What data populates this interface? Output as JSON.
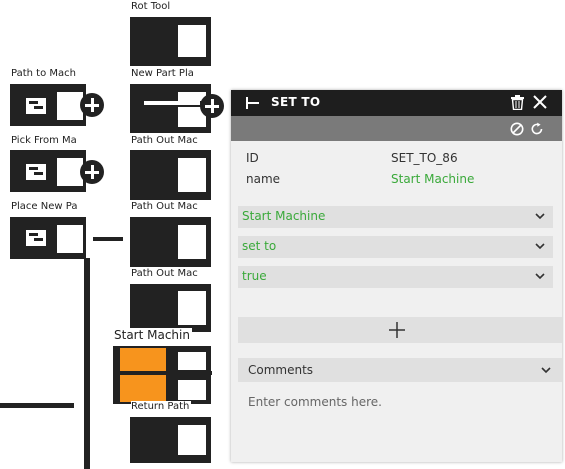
{
  "canvas": {
    "blocks": [
      {
        "label": "Rot Tool"
      },
      {
        "label": "Path to Mach"
      },
      {
        "label": "New Part Pla"
      },
      {
        "label": "Pick From Ma"
      },
      {
        "label": "Path Out Mac"
      },
      {
        "label": "Place New Pa"
      },
      {
        "label": "Path Out Mac"
      },
      {
        "label": "Path Out Mac"
      },
      {
        "label": "Start Machin"
      },
      {
        "label": "Return Path"
      }
    ],
    "active_color": "#f7941d"
  },
  "panel": {
    "title": "SET TO",
    "props": [
      {
        "key": "ID",
        "value": "SET_TO_86"
      },
      {
        "key": "name",
        "value": "Start Machine"
      }
    ],
    "selects": [
      {
        "value": "Start Machine"
      },
      {
        "value": "set to"
      },
      {
        "value": "true"
      }
    ],
    "comments_label": "Comments",
    "comments_placeholder": "Enter comments here.",
    "accent": "#3aa93a"
  }
}
